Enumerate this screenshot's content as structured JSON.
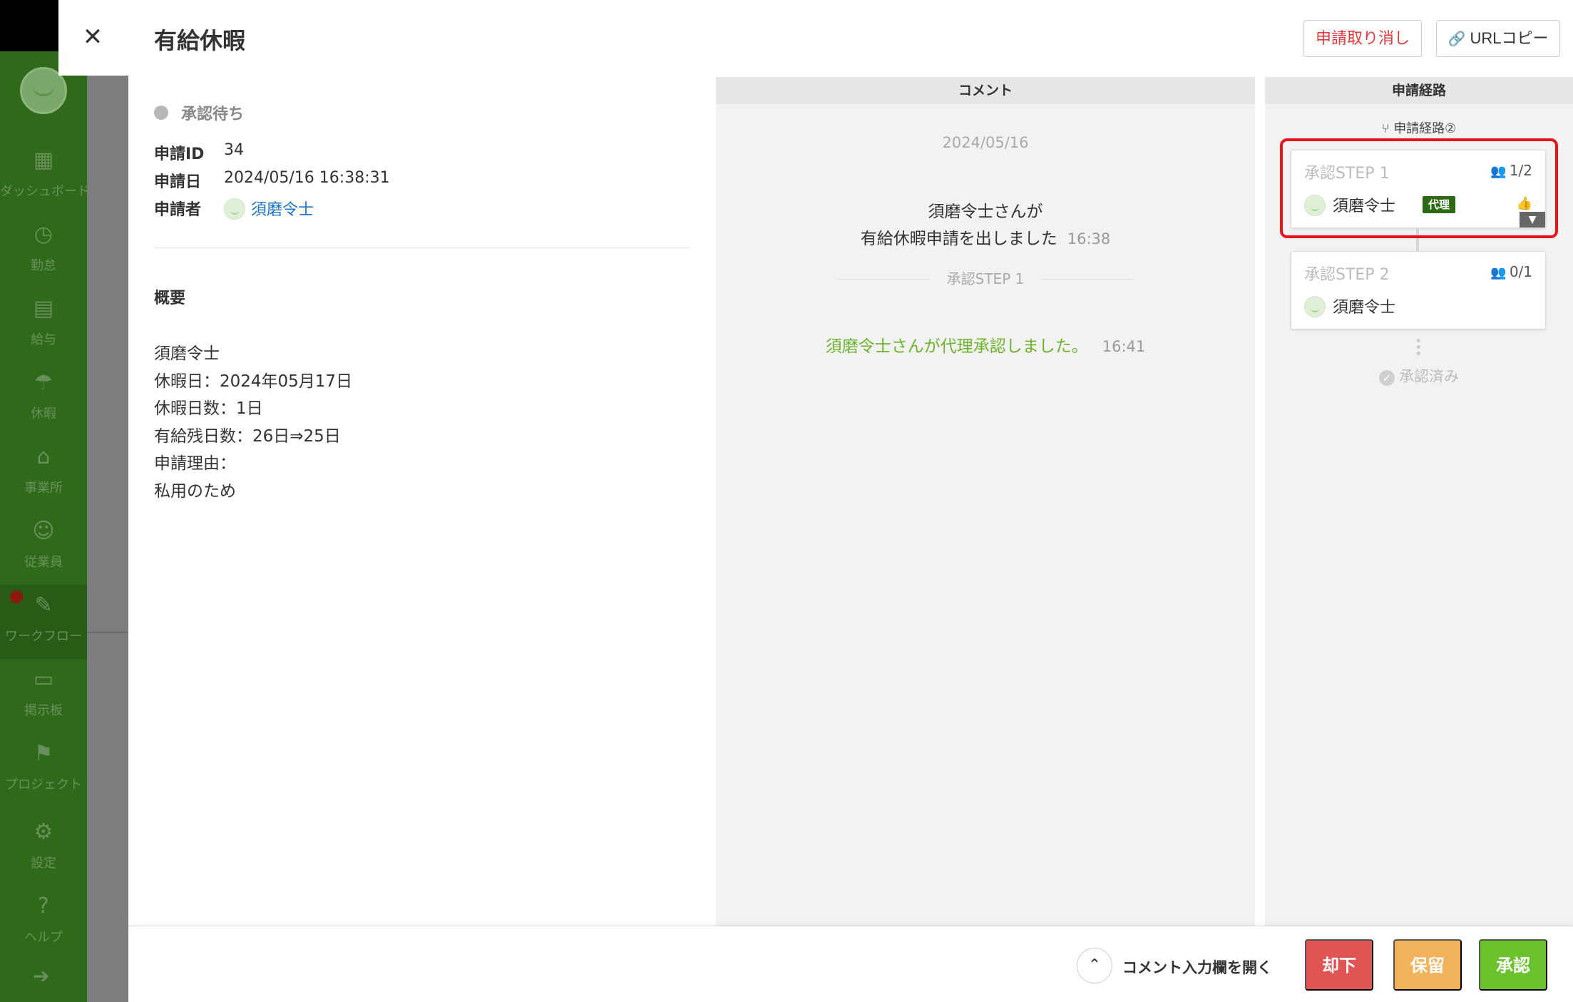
{
  "sidebar": {
    "items": [
      {
        "label": "ダッシュボード",
        "icon": "dashboard-icon"
      },
      {
        "label": "勤怠",
        "icon": "clock-icon"
      },
      {
        "label": "給与",
        "icon": "calculator-icon"
      },
      {
        "label": "休暇",
        "icon": "umbrella-icon"
      },
      {
        "label": "事業所",
        "icon": "home-icon"
      },
      {
        "label": "従業員",
        "icon": "user-icon"
      },
      {
        "label": "ワークフロー",
        "icon": "workflow-icon"
      },
      {
        "label": "掲示板",
        "icon": "message-icon"
      },
      {
        "label": "プロジェクト",
        "icon": "flag-icon"
      },
      {
        "label": "設定",
        "icon": "gear-icon"
      },
      {
        "label": "ヘルプ",
        "icon": "help-icon"
      }
    ]
  },
  "header": {
    "close": "✕",
    "title": "有給休暇",
    "cancel_label": "申請取り消し",
    "url_copy_label": "URLコピー"
  },
  "detail": {
    "status": "承認待ち",
    "id_label": "申請ID",
    "id_value": "34",
    "date_label": "申請日",
    "date_value": "2024/05/16 16:38:31",
    "applicant_label": "申請者",
    "applicant_name": "須磨令士",
    "summary_title": "概要",
    "summary_lines": [
      "須磨令士",
      "休暇日：2024年05月17日",
      "休暇日数：1日",
      "有給残日数：26日⇒25日",
      "申請理由：",
      "私用のため"
    ]
  },
  "comments": {
    "header": "コメント",
    "date": "2024/05/16",
    "msg_line1": "須磨令士さんが",
    "msg_line2": "有給休暇申請を出しました",
    "msg_time": "16:38",
    "step_divider": "承認STEP 1",
    "approve_msg": "須磨令士さんが代理承認しました。",
    "approve_time": "16:41"
  },
  "route": {
    "header": "申請経路",
    "route_name": "申請経路②",
    "steps": [
      {
        "title": "承認STEP 1",
        "count": "1/2",
        "approver": "須磨令士",
        "badge": "代理"
      },
      {
        "title": "承認STEP 2",
        "count": "0/1",
        "approver": "須磨令士"
      }
    ],
    "approved_label": "承認済み"
  },
  "footer": {
    "open_comment_label": "コメント入力欄を開く",
    "reject_label": "却下",
    "hold_label": "保留",
    "approve_label": "承認"
  },
  "colors": {
    "accent_green": "#6cc22c",
    "reject_red": "#e05454",
    "hold_orange": "#f2b25b",
    "highlight_red": "#e8141c"
  }
}
